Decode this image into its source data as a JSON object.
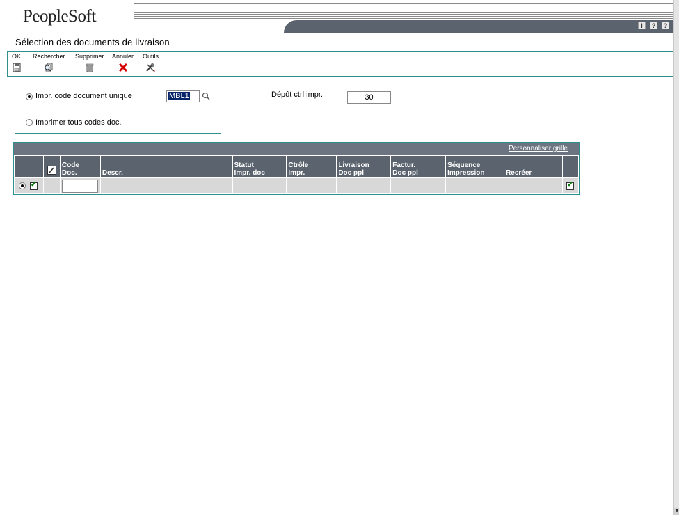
{
  "header": {
    "logo": "PeopleSoft",
    "logo_suffix": ".",
    "icons": [
      "i",
      "?",
      "?"
    ]
  },
  "page": {
    "title": "Sélection des documents de livraison"
  },
  "toolbar": {
    "ok_label": "OK",
    "search_label": "Rechercher",
    "delete_label": "Supprimer",
    "cancel_label": "Annuler",
    "tools_label": "Outils"
  },
  "options": {
    "single_label": "Impr. code document unique",
    "single_selected": true,
    "single_code_value": "MBL1",
    "all_label": "Imprimer tous codes doc."
  },
  "depot": {
    "label": "Dépôt ctrl impr.",
    "value": "30"
  },
  "grid": {
    "customize_link": "Personnaliser grille",
    "headers": {
      "code": [
        "Code",
        "Doc."
      ],
      "descr": "Descr.",
      "status": [
        "Statut",
        "Impr. doc"
      ],
      "ctrl": [
        "Ctrôle",
        "Impr."
      ],
      "delivery": [
        "Livraison",
        "Doc ppl"
      ],
      "invoice": [
        "Factur.",
        "Doc ppl"
      ],
      "sequence": [
        "Séquence",
        "Impression"
      ],
      "recreate": "Recréer"
    }
  },
  "colors": {
    "border_teal": "#2f8f8f",
    "header_slate": "#5a636e",
    "grid_bar": "#6b7480",
    "cell_gray": "#d8d8d8"
  }
}
